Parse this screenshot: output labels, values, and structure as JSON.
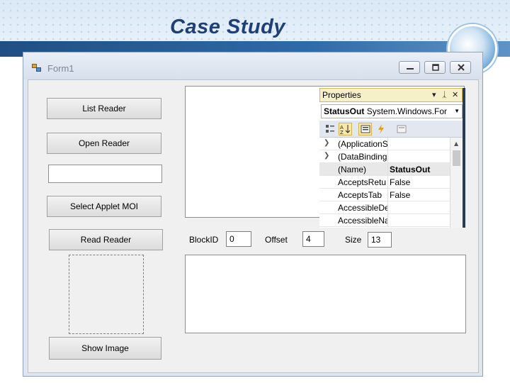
{
  "slide": {
    "title": "Case Study"
  },
  "window": {
    "title": "Form1"
  },
  "buttons": {
    "list_reader": "List Reader",
    "open_reader": "Open Reader",
    "select_applet": "Select Applet MOI",
    "read_reader": "Read Reader",
    "show_image": "Show Image"
  },
  "fields": {
    "block_id_label": "BlockID",
    "block_id_value": "0",
    "offset_label": "Offset",
    "offset_value": "4",
    "size_label": "Size",
    "size_value": "13"
  },
  "properties": {
    "title": "Properties",
    "object_name": "StatusOut",
    "object_type": "System.Windows.For",
    "rows": [
      {
        "name": "(ApplicationS",
        "value": "",
        "expandable": true
      },
      {
        "name": "(DataBindings",
        "value": "",
        "expandable": true
      },
      {
        "name": "(Name)",
        "value": "StatusOut",
        "expandable": false
      },
      {
        "name": "AcceptsRetu",
        "value": "False",
        "expandable": false
      },
      {
        "name": "AcceptsTab",
        "value": "False",
        "expandable": false
      },
      {
        "name": "AccessibleDe",
        "value": "",
        "expandable": false
      },
      {
        "name": "AccessibleNa",
        "value": "",
        "expandable": false
      }
    ]
  },
  "icons": {
    "minimize": "minimize-icon",
    "maximize": "maximize-icon",
    "close": "close-icon"
  }
}
